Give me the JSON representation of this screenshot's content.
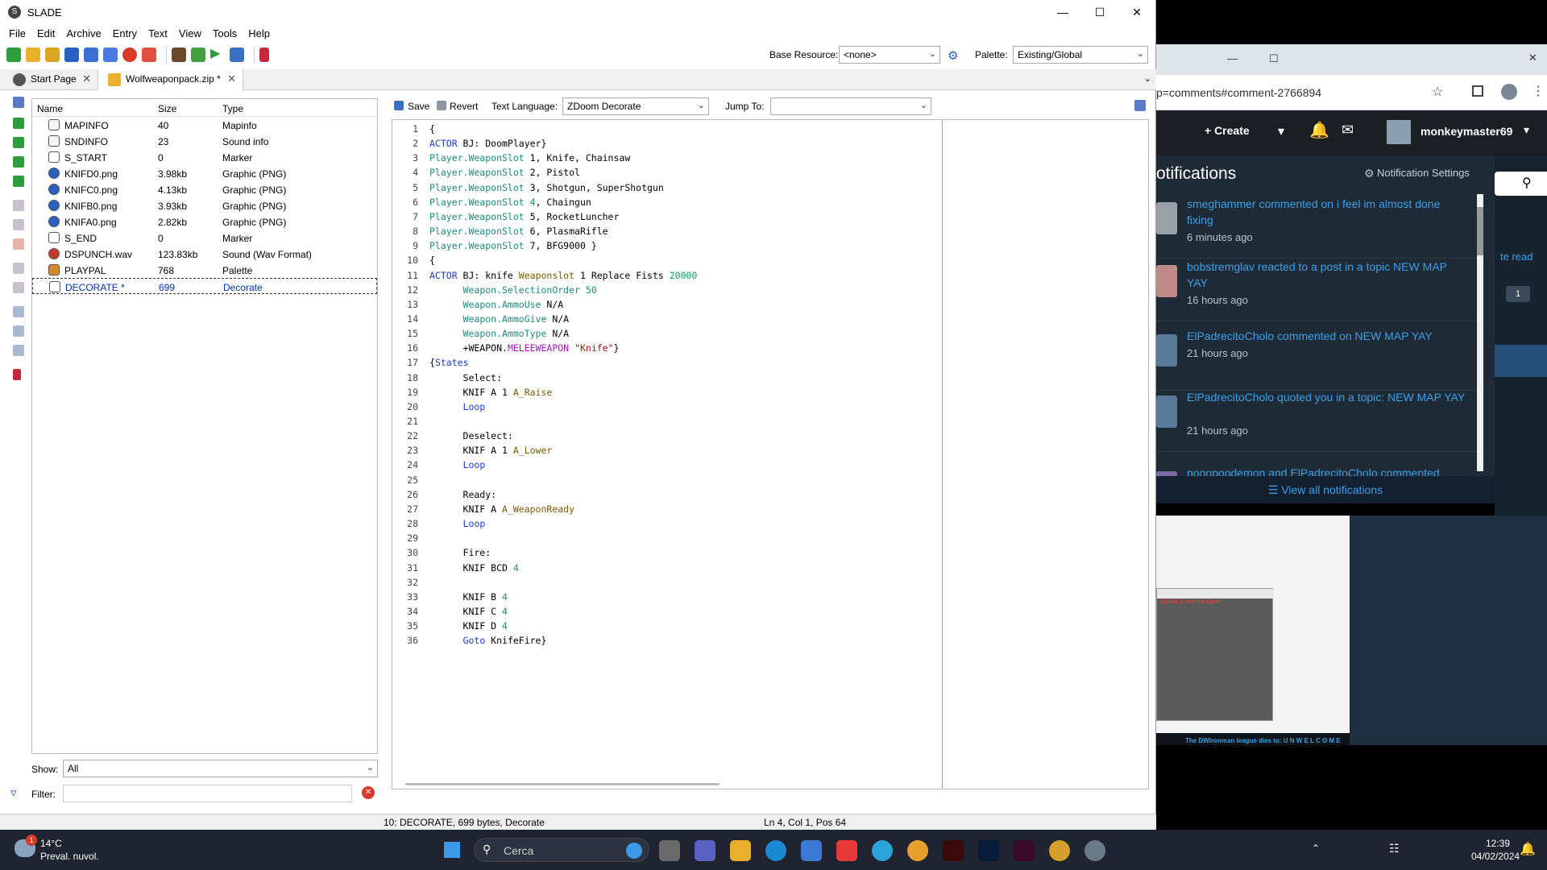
{
  "window": {
    "title": "SLADE"
  },
  "menu": [
    "File",
    "Edit",
    "Archive",
    "Entry",
    "Text",
    "View",
    "Tools",
    "Help"
  ],
  "toolbar": {
    "base_resource_label": "Base Resource:",
    "base_resource_value": "<none>",
    "palette_label": "Palette:",
    "palette_value": "Existing/Global"
  },
  "tabs": [
    {
      "label": "Start Page"
    },
    {
      "label": "Wolfweaponpack.zip *"
    }
  ],
  "entry_list": {
    "headers": {
      "name": "Name",
      "size": "Size",
      "type": "Type"
    },
    "rows": [
      {
        "name": "MAPINFO",
        "size": "40",
        "type": "Mapinfo",
        "icon": "text-file-icon"
      },
      {
        "name": "SNDINFO",
        "size": "23",
        "type": "Sound info",
        "icon": "text-file-icon"
      },
      {
        "name": "S_START",
        "size": "0",
        "type": "Marker",
        "icon": "marker-icon"
      },
      {
        "name": "KNIFD0.png",
        "size": "3.98kb",
        "type": "Graphic (PNG)",
        "icon": "png-icon"
      },
      {
        "name": "KNIFC0.png",
        "size": "4.13kb",
        "type": "Graphic (PNG)",
        "icon": "png-icon"
      },
      {
        "name": "KNIFB0.png",
        "size": "3.93kb",
        "type": "Graphic (PNG)",
        "icon": "png-icon"
      },
      {
        "name": "KNIFA0.png",
        "size": "2.82kb",
        "type": "Graphic (PNG)",
        "icon": "png-icon"
      },
      {
        "name": "S_END",
        "size": "0",
        "type": "Marker",
        "icon": "marker-icon"
      },
      {
        "name": "DSPUNCH.wav",
        "size": "123.83kb",
        "type": "Sound (Wav Format)",
        "icon": "sound-icon"
      },
      {
        "name": "PLAYPAL",
        "size": "768",
        "type": "Palette",
        "icon": "palette-icon"
      },
      {
        "name": "DECORATE *",
        "size": "699",
        "type": "Decorate",
        "icon": "decorate-icon"
      }
    ],
    "show_label": "Show:",
    "show_value": "All",
    "filter_label": "Filter:",
    "filter_value": ""
  },
  "editor_toolbar": {
    "save": "Save",
    "revert": "Revert",
    "text_language_label": "Text Language:",
    "text_language_value": "ZDoom Decorate",
    "jump_to_label": "Jump To:",
    "jump_to_value": ""
  },
  "code_lines": [
    "{",
    "ACTOR BJ: DoomPlayer}",
    "Player.WeaponSlot 1, Knife, Chainsaw",
    "Player.WeaponSlot 2, Pistol",
    "Player.WeaponSlot 3, Shotgun, SuperShotgun",
    "Player.WeaponSlot 4, Chaingun",
    "Player.WeaponSlot 5, RocketLuncher",
    "Player.WeaponSlot 6, PlasmaRifle",
    "Player.WeaponSlot 7, BFG9000 }",
    "{",
    "ACTOR BJ: knife Weaponslot 1 Replace Fists 20000",
    "      Weapon.SelectionOrder 50",
    "      Weapon.AmmoUse N/A",
    "      Weapon.AmmoGive N/A",
    "      Weapon.AmmoType N/A",
    "      +WEAPON.MELEEWEAPON \"Knife\"}",
    "{States",
    "      Select:",
    "      KNIF A 1 A_Raise",
    "      Loop",
    "",
    "      Deselect:",
    "      KNIF A 1 A_Lower",
    "      Loop",
    "",
    "      Ready:",
    "      KNIF A A_WeaponReady",
    "      Loop",
    "",
    "      Fire:",
    "      KNIF BCD 4",
    "",
    "      KNIF B 4",
    "      KNIF C 4",
    "      KNIF D 4",
    "      Goto KnifeFire}"
  ],
  "status": {
    "left": "10: DECORATE, 699 bytes, Decorate",
    "right": "Ln 4, Col 1, Pos 64"
  },
  "browser": {
    "url": "p=comments#comment-2766894",
    "create": "+ Create",
    "username": "monkeymaster69",
    "notifications_title": "otifications",
    "notification_settings": "Notification Settings",
    "side_text_1": "te read",
    "side_badge": "1",
    "notifications": [
      {
        "text": "smeghammer commented on i feel im almost done fixing",
        "time": "6 minutes ago"
      },
      {
        "text": "bobstremglav reacted to a post in a topic NEW MAP YAY",
        "time": "16 hours ago"
      },
      {
        "text": "ElPadrecitoCholo commented on NEW MAP YAY",
        "time": "21 hours ago"
      },
      {
        "text": "ElPadrecitoCholo quoted you in a topic: NEW MAP YAY",
        "time": "21 hours ago"
      },
      {
        "text": "pooopoodemon and ElPadrecitoCholo commented",
        "time": ""
      }
    ],
    "view_all": "View all notifications",
    "thumb_title": "DOOM 2: Hell on Earth",
    "thumb_footer": "The DWIronman league dies to: U N W E L C O M E"
  },
  "taskbar": {
    "weather_temp": "14°C",
    "weather_desc": "Preval. nuvol.",
    "search_placeholder": "Cerca",
    "time": "12:39",
    "date": "04/02/2024",
    "weather_badge": "1"
  },
  "colors": {
    "keyword": "#1a3acc",
    "property": "#1f8a7a",
    "number": "#0d9b57",
    "link": "#3aa0e8"
  }
}
